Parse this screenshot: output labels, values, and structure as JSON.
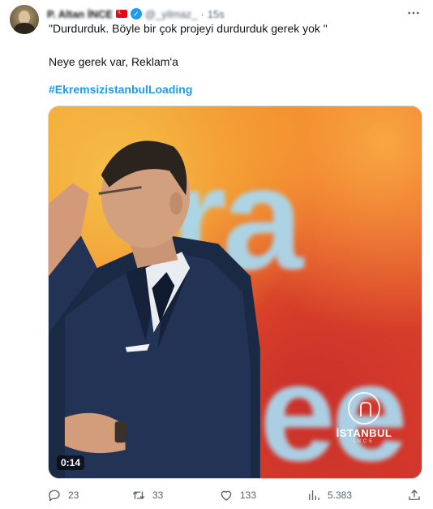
{
  "tweet": {
    "author_name": "P. Altan İNCE",
    "handle": "@_yilmaz_",
    "separator": "·",
    "time": "15s",
    "text_line1": "\"Durdurduk. Böyle bir çok projeyi durdurduk gerek yok \"",
    "text_line2": "Neye gerek var, Reklam'a",
    "hashtag": "#EkremsizistanbulLoading"
  },
  "media": {
    "duration": "0:14",
    "logo_title": "İSTANBUL",
    "logo_sub": "İNCE",
    "bg_text_top": "ra",
    "bg_text_bottom": "ee"
  },
  "actions": {
    "replies": "23",
    "retweets": "33",
    "likes": "133",
    "views": "5.383"
  },
  "icons": [
    "avatar",
    "turkey-flag-icon",
    "verified-badge-icon",
    "more-icon",
    "reply-icon",
    "retweet-icon",
    "like-icon",
    "views-icon",
    "share-icon"
  ],
  "colors": {
    "accent": "#1d9bf0",
    "muted": "#536471",
    "text": "#0f1419"
  }
}
